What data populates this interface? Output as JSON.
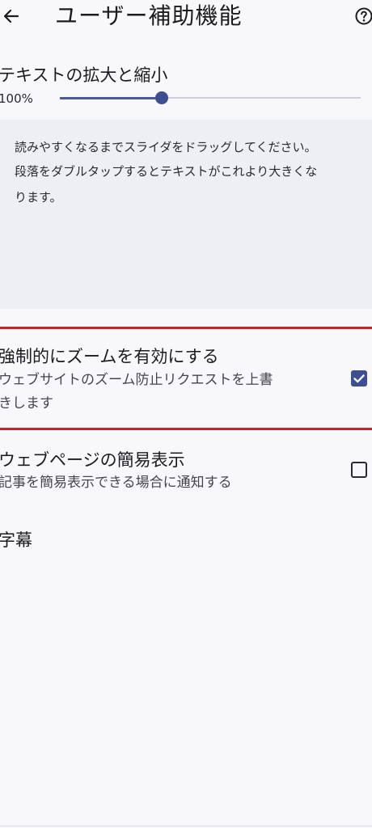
{
  "header": {
    "title": "ユーザー補助機能",
    "back_icon": "arrow-left-icon",
    "help_icon": "help-circle-icon"
  },
  "text_zoom": {
    "title": "テキストの拡大と縮小",
    "value_label": "100%",
    "slider_level": 0.34,
    "preview_lines": [
      "読みやすくなるまでスライダをドラッグしてください。",
      "段落をダブルタップするとテキストがこれより大きくな",
      "ります。"
    ]
  },
  "force_zoom": {
    "title": "強制的にズームを有効にする",
    "subtitle_lines": [
      "ウェブサイトのズーム防止リクエストを上書",
      "きします"
    ],
    "checked": true
  },
  "simplified_view": {
    "title": "ウェブページの簡易表示",
    "subtitle": "記事を簡易表示できる場合に通知する",
    "checked": false
  },
  "captions": {
    "title": "字幕"
  },
  "colors": {
    "accent": "#3d4f91",
    "highlight_border": "#c4262e",
    "background": "#f8f7fc",
    "preview_background": "#eeeef5"
  }
}
